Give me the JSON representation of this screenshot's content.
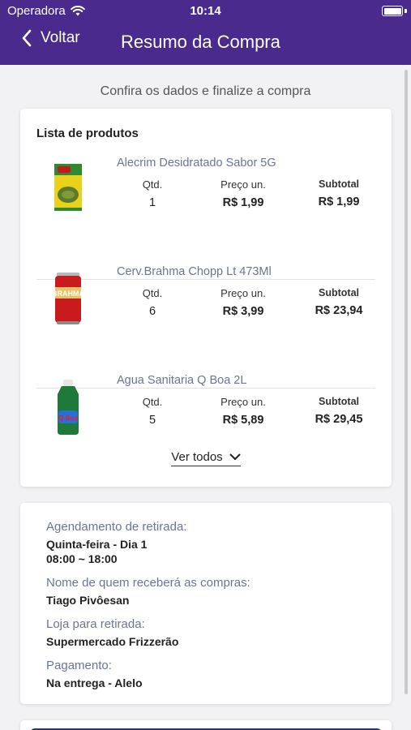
{
  "status": {
    "carrier": "Operadora",
    "time": "10:14"
  },
  "nav": {
    "back_label": "Voltar",
    "title": "Resumo da Compra"
  },
  "intro": "Confira os dados e finalize a compra",
  "products": {
    "heading": "Lista de produtos",
    "qty_label": "Qtd.",
    "price_label": "Preço un.",
    "subtotal_label": "Subtotal",
    "items": [
      {
        "name": "Alecrim Desidratado Sabor 5G",
        "qty": "1",
        "price": "R$ 1,99",
        "subtotal": "R$ 1,99",
        "icon": "spice-package-icon"
      },
      {
        "name": "Cerv.Brahma Chopp Lt 473Ml",
        "qty": "6",
        "price": "R$ 3,99",
        "subtotal": "R$ 23,94",
        "icon": "beer-can-icon"
      },
      {
        "name": "Agua Sanitaria Q Boa 2L",
        "qty": "5",
        "price": "R$ 5,89",
        "subtotal": "R$ 29,45",
        "icon": "bleach-bottle-icon"
      }
    ],
    "see_all": "Ver todos"
  },
  "details": {
    "pickup_label": "Agendamento de retirada:",
    "pickup_day": "Quinta-feira - Dia 1",
    "pickup_time": "08:00 ~ 18:00",
    "receiver_label": "Nome de quem receberá as compras:",
    "receiver_value": "Tiago Pivôesan",
    "store_label": "Loja para retirada:",
    "store_value": "Supermercado Frizzerão",
    "payment_label": "Pagamento:",
    "payment_value": "Na entrega - Alelo"
  },
  "colors": {
    "header": "#4a2a8c",
    "muted_text": "#6a7596",
    "button": "#27397a"
  }
}
